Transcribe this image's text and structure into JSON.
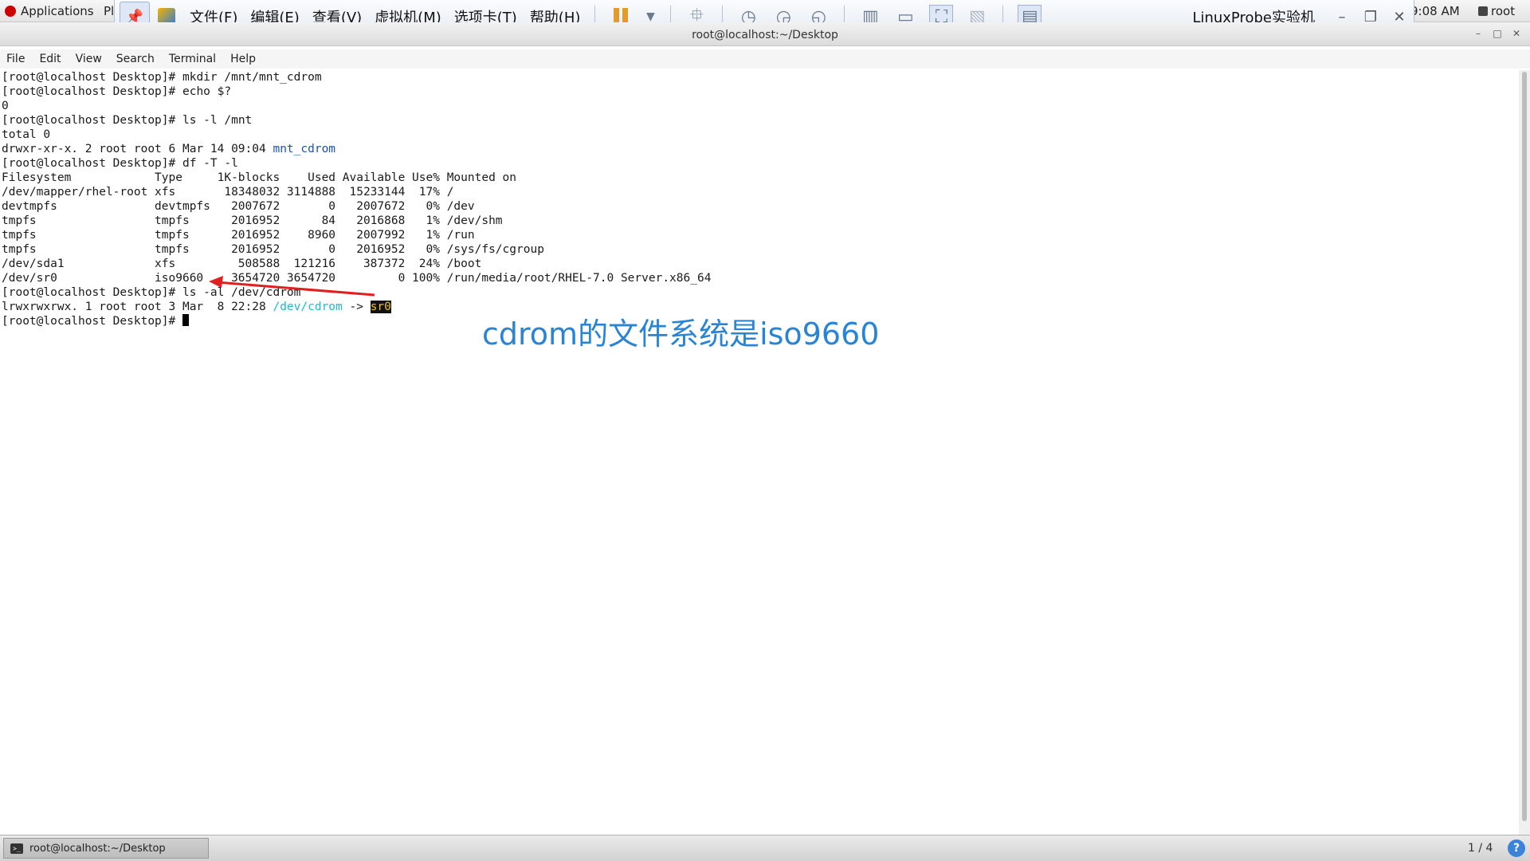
{
  "gnome_bar": {
    "applications_label": "Applications",
    "places_label": "Pl",
    "clock": "9:08 AM",
    "user": "root"
  },
  "vmware_toolbar": {
    "menus": [
      "文件(F)",
      "编辑(E)",
      "查看(V)",
      "虚拟机(M)",
      "选项卡(T)",
      "帮助(H)"
    ],
    "title": "LinuxProbe实验机"
  },
  "terminal": {
    "window_title": "root@localhost:~/Desktop",
    "menu": [
      "File",
      "Edit",
      "View",
      "Search",
      "Terminal",
      "Help"
    ],
    "prompt": "[root@localhost Desktop]# ",
    "lines": {
      "l1_cmd": "mkdir /mnt/mnt_cdrom",
      "l2_cmd": "echo $?",
      "l3": "0",
      "l4_cmd": "ls -l /mnt",
      "l5": "total 0",
      "l6_pre": "drwxr-xr-x. 2 root root 6 Mar 14 09:04 ",
      "l6_link": "mnt_cdrom",
      "l7_cmd": "df -T -l",
      "l8": "Filesystem            Type     1K-blocks    Used Available Use% Mounted on",
      "l9": "/dev/mapper/rhel-root xfs       18348032 3114888  15233144  17% /",
      "l10": "devtmpfs              devtmpfs   2007672       0   2007672   0% /dev",
      "l11": "tmpfs                 tmpfs      2016952      84   2016868   1% /dev/shm",
      "l12": "tmpfs                 tmpfs      2016952    8960   2007992   1% /run",
      "l13": "tmpfs                 tmpfs      2016952       0   2016952   0% /sys/fs/cgroup",
      "l14": "/dev/sda1             xfs         508588  121216    387372  24% /boot",
      "l15": "/dev/sr0              iso9660    3654720 3654720         0 100% /run/media/root/RHEL-7.0 Server.x86_64",
      "l16_cmd": "ls -al /dev/cdrom",
      "l17_pre": "lrwxrwxrwx. 1 root root 3 Mar  8 22:28 ",
      "l17_link": "/dev/cdrom",
      "l17_arrow": " -> ",
      "l17_target": "sr0"
    }
  },
  "annotation": "cdrom的文件系统是iso9660",
  "taskbar": {
    "item_label": "root@localhost:~/Desktop",
    "workspace": "1 / 4",
    "help": "?"
  },
  "colors": {
    "annotation": "#2a84d6",
    "arrow": "#e02020",
    "link_blue": "#1a4fc4",
    "link_cyan": "#21b8c9",
    "highlight_bg": "#111111",
    "highlight_fg": "#f0c419"
  }
}
